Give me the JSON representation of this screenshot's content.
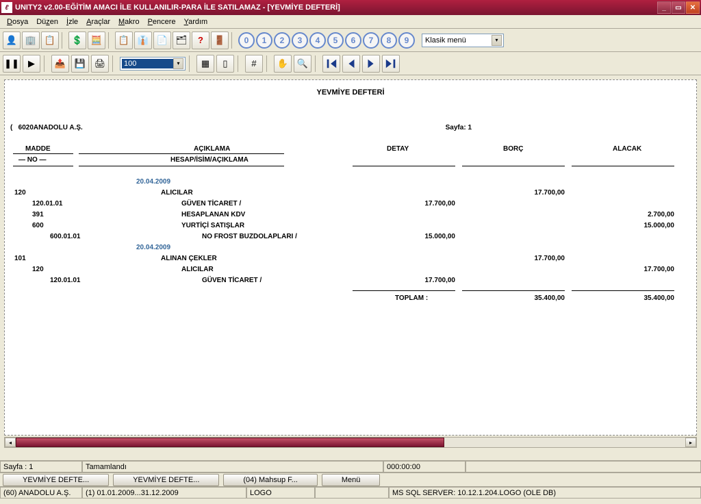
{
  "window": {
    "title": "UNITY2 v2.00-EĞİTİM AMACI İLE KULLANILIR-PARA İLE SATILAMAZ - [YEVMİYE DEFTERİ]"
  },
  "menu": {
    "file": "Dosya",
    "edit": "Düzen",
    "watch": "İzle",
    "tools": "Araçlar",
    "macro": "Makro",
    "window": "Pencere",
    "help": "Yardım"
  },
  "toolbar": {
    "style_combo": "Klasik menü",
    "zoom_value": "100",
    "numbers": [
      "0",
      "1",
      "2",
      "3",
      "4",
      "5",
      "6",
      "7",
      "8",
      "9"
    ]
  },
  "report": {
    "title": "YEVMİYE DEFTERİ",
    "company_code": "6020",
    "company_name": "ANADOLU A.Ş.",
    "page_label": "Sayfa:",
    "page_no": "1",
    "cols": {
      "madde": "MADDE",
      "no": "NO",
      "aciklama": "AÇIKLAMA",
      "hesap": "HESAP/İSİM/AÇIKLAMA",
      "detay": "DETAY",
      "borc": "BORÇ",
      "alacak": "ALACAK"
    },
    "toplam_label": "TOPLAM  :",
    "toplam_borc": "35.400,00",
    "toplam_alacak": "35.400,00",
    "lines": [
      {
        "type": "date",
        "text": "20.04.2009"
      },
      {
        "no": "120",
        "desc": "ALICILAR",
        "borc": "17.700,00"
      },
      {
        "no": "120.01.01",
        "indent": 1,
        "desc": "GÜVEN TİCARET /",
        "detay": "17.700,00"
      },
      {
        "no": "391",
        "indent": 1,
        "desc": "HESAPLANAN KDV",
        "alacak": "2.700,00"
      },
      {
        "no": "600",
        "indent": 1,
        "desc": "YURTİÇİ SATIŞLAR",
        "alacak": "15.000,00"
      },
      {
        "no": "600.01.01",
        "indent": 2,
        "desc": "NO FROST BUZDOLAPLARI /",
        "detay": "15.000,00"
      },
      {
        "type": "date",
        "text": "20.04.2009"
      },
      {
        "no": "101",
        "desc": "ALINAN ÇEKLER",
        "borc": "17.700,00"
      },
      {
        "no": "120",
        "indent": 1,
        "desc": "ALICILAR",
        "alacak": "17.700,00"
      },
      {
        "no": "120.01.01",
        "indent": 2,
        "desc": "GÜVEN TİCARET /",
        "detay": "17.700,00"
      }
    ]
  },
  "status1": {
    "page": "Sayfa : 1",
    "state": "Tamamlandı",
    "time": "000:00:00"
  },
  "tabs": {
    "t1": "YEVMİYE DEFTE...",
    "t2": "YEVMİYE DEFTE...",
    "t3": "(04) Mahsup F...",
    "t4": "Menü"
  },
  "status2": {
    "company": "(60) ANADOLU A.Ş.",
    "period": "(1) 01.01.2009...31.12.2009",
    "brand": "LOGO",
    "server": "MS SQL SERVER: 10.12.1.204.LOGO (OLE DB)"
  }
}
